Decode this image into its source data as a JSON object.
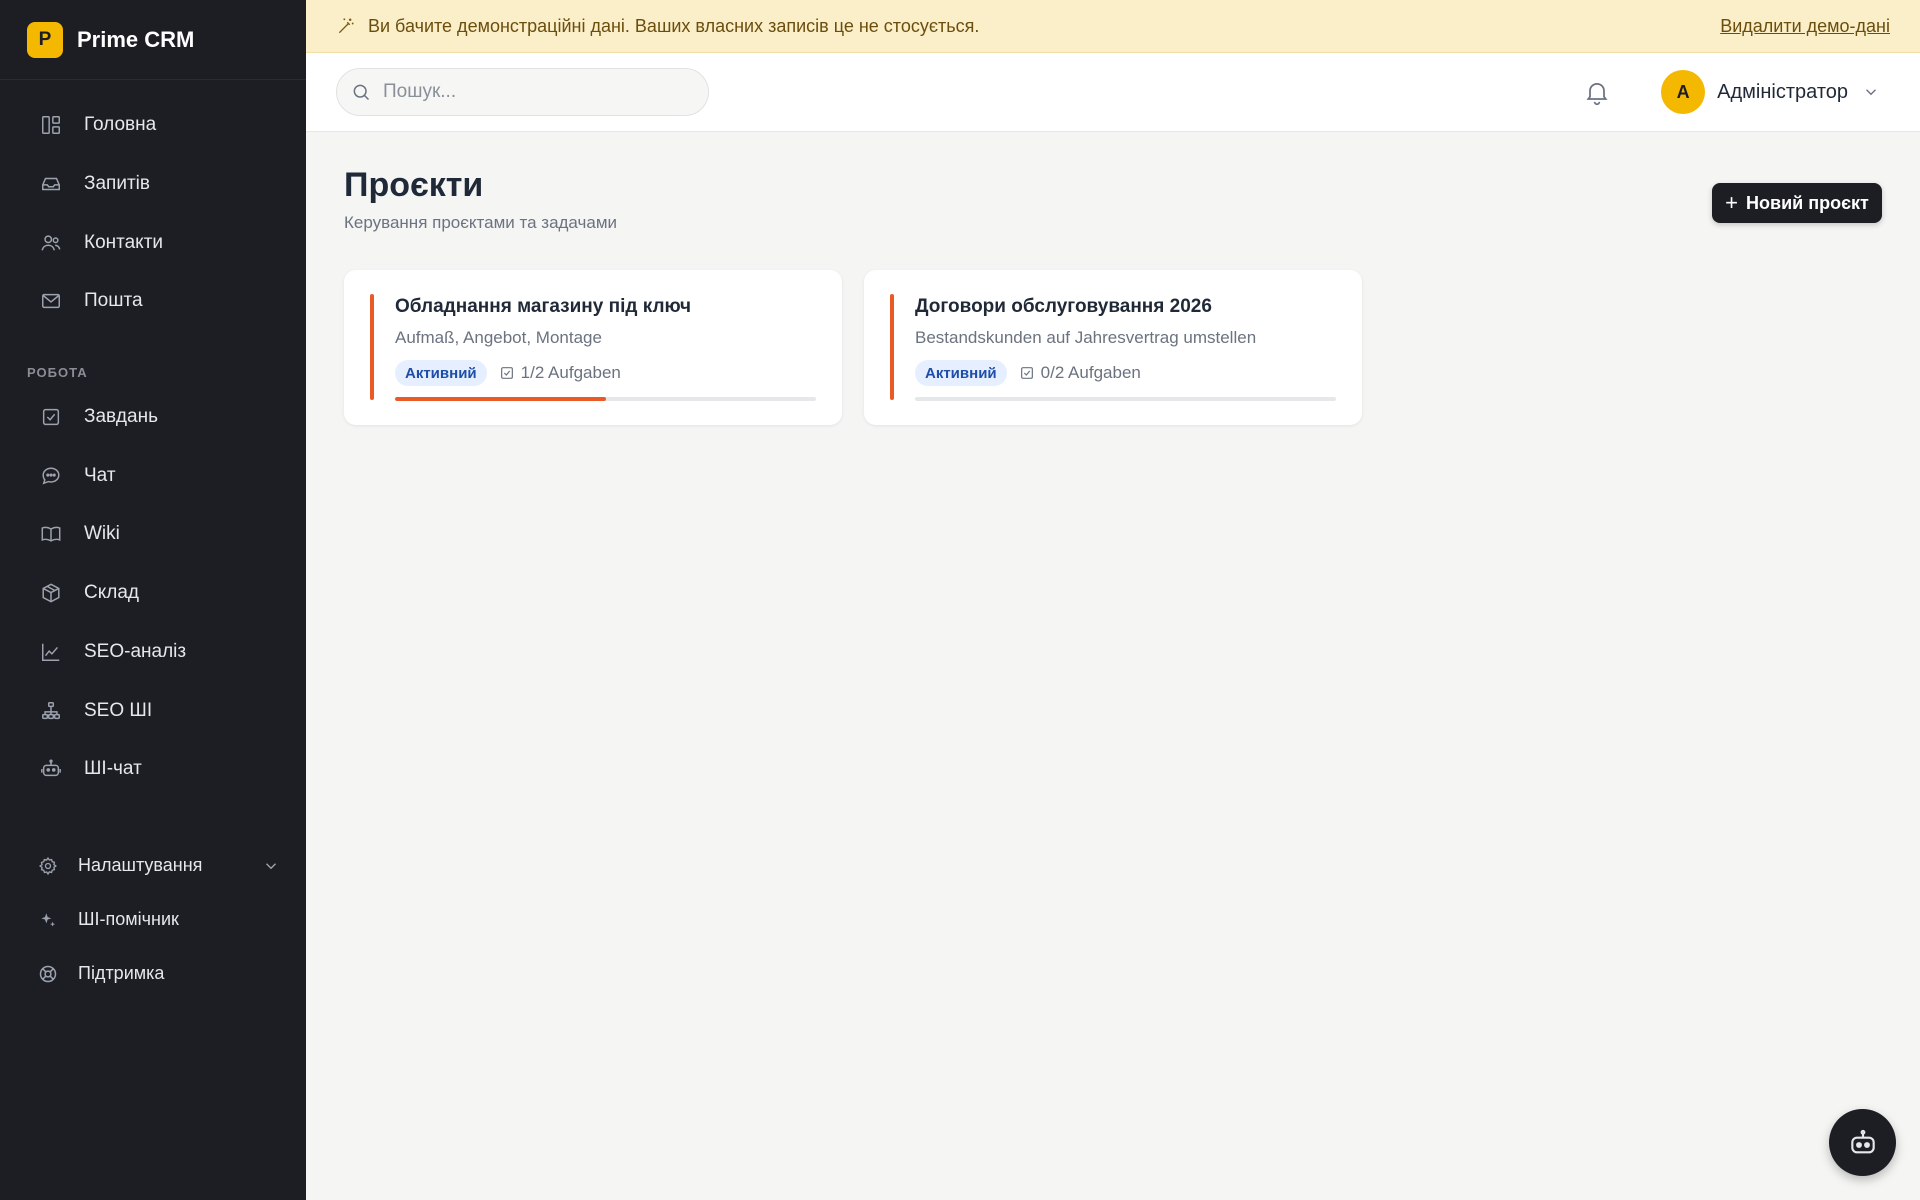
{
  "app": {
    "logo_letter": "P",
    "name": "Prime CRM"
  },
  "sidebar": {
    "main": [
      {
        "label": "Головна",
        "icon": "dashboard-icon"
      },
      {
        "label": "Запитів",
        "icon": "inbox-icon"
      },
      {
        "label": "Контакти",
        "icon": "users-icon"
      },
      {
        "label": "Пошта",
        "icon": "mail-icon"
      }
    ],
    "section_title": "РОБОТА",
    "work": [
      {
        "label": "Завдань",
        "icon": "checkbox-icon"
      },
      {
        "label": "Чат",
        "icon": "chat-icon"
      },
      {
        "label": "Wiki",
        "icon": "book-icon"
      },
      {
        "label": "Склад",
        "icon": "box-icon"
      },
      {
        "label": "SEO-аналіз",
        "icon": "chart-icon"
      },
      {
        "label": "SEO ШІ",
        "icon": "network-icon"
      },
      {
        "label": "ШІ-чат",
        "icon": "robot-icon"
      }
    ],
    "bottom": [
      {
        "label": "Налаштування",
        "icon": "gear-icon"
      },
      {
        "label": "ШІ-помічник",
        "icon": "sparkle-icon"
      },
      {
        "label": "Підтримка",
        "icon": "lifebuoy-icon"
      }
    ]
  },
  "banner": {
    "text": "Ви бачите демонстраційні дані. Ваших власних записів це не стосується.",
    "link": "Видалити демо-дані"
  },
  "header": {
    "search_placeholder": "Пошук...",
    "user_initial": "A",
    "user_name": "Адміністратор"
  },
  "page": {
    "title": "Проєкти",
    "subtitle": "Керування проєктами та задачами",
    "new_button": "Новий проєкт"
  },
  "projects": [
    {
      "title": "Обладнання магазину під ключ",
      "description": "Aufmaß, Angebot, Montage",
      "status": "Активний",
      "tasks": "1/2 Aufgaben",
      "progress": 0.5
    },
    {
      "title": "Договори обслуговування 2026",
      "description": "Bestandskunden auf Jahresvertrag umstellen",
      "status": "Активний",
      "tasks": "0/2 Aufgaben",
      "progress": 0
    }
  ],
  "colors": {
    "sidebar_bg": "#1d1e24",
    "brand": "#f5b800",
    "accent": "#ea5a26",
    "badge_bg": "#e6efff",
    "badge_text": "#1e4ea8",
    "banner_bg": "#fbefc9"
  }
}
